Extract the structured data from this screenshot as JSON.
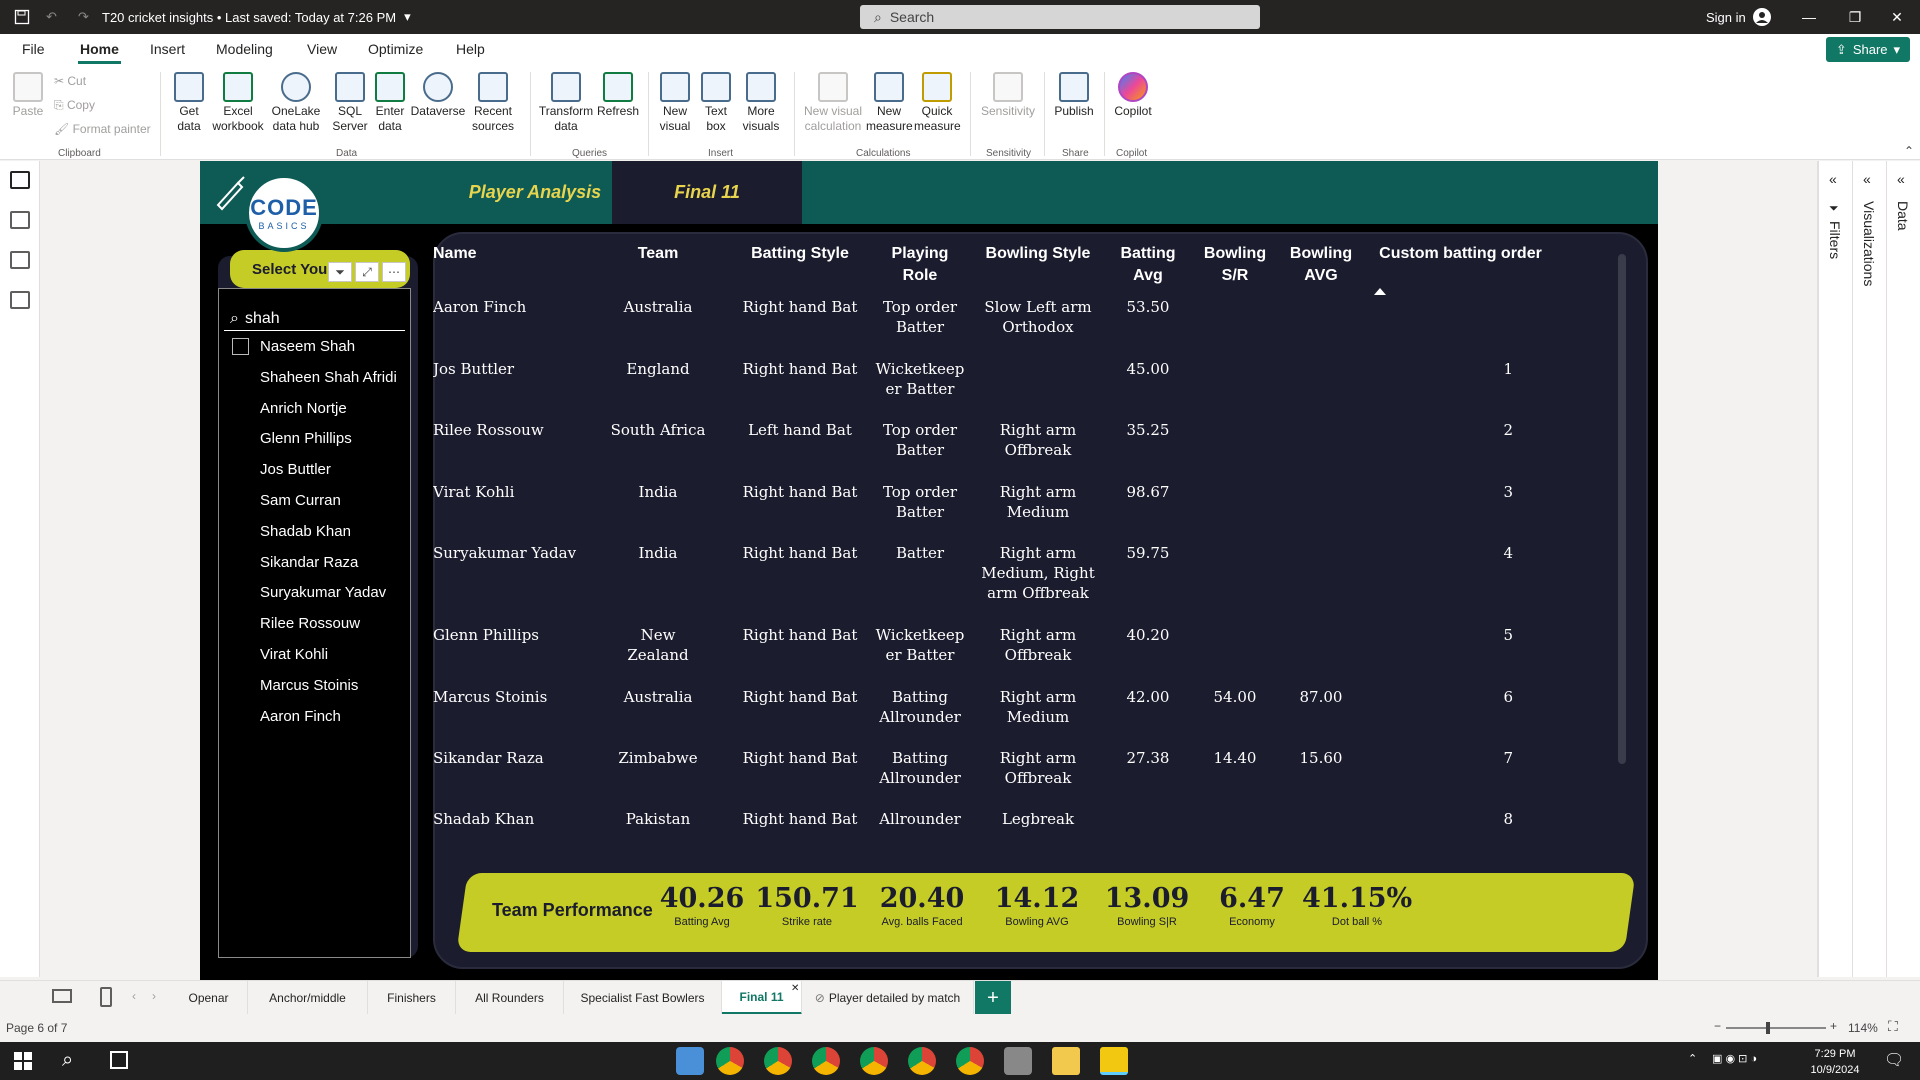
{
  "titlebar": {
    "title": "T20 cricket insights • Last saved: Today at 7:26 PM",
    "search_placeholder": "Search",
    "signin": "Sign in"
  },
  "menu": {
    "tabs": [
      "File",
      "Home",
      "Insert",
      "Modeling",
      "View",
      "Optimize",
      "Help"
    ],
    "share": "Share"
  },
  "ribbon": {
    "clipboard": {
      "paste": "Paste",
      "cut": "Cut",
      "copy": "Copy",
      "format_painter": "Format painter",
      "group": "Clipboard"
    },
    "data": {
      "get_data": "Get data",
      "excel": "Excel workbook",
      "onelake": "OneLake data hub",
      "sql": "SQL Server",
      "enter": "Enter data",
      "dataverse": "Dataverse",
      "recent": "Recent sources",
      "group": "Data"
    },
    "queries": {
      "transform": "Transform data",
      "refresh": "Refresh",
      "group": "Queries"
    },
    "insert": {
      "new_visual": "New visual",
      "text_box": "Text box",
      "more_visuals": "More visuals",
      "group": "Insert"
    },
    "calculations": {
      "new_visual_calc": "New visual calculation",
      "new_measure": "New measure",
      "quick_measure": "Quick measure",
      "group": "Calculations"
    },
    "sensitivity": {
      "sensitivity": "Sensitivity",
      "group": "Sensitivity"
    },
    "share": {
      "publish": "Publish",
      "group": "Share"
    },
    "copilot": {
      "copilot": "Copilot",
      "group": "Copilot"
    }
  },
  "report": {
    "nav": {
      "player_analysis": "Player Analysis",
      "final11": "Final 11"
    },
    "logo": {
      "line1": "CODE",
      "line2": "BASICS"
    },
    "slicer": {
      "title": "Select Your",
      "search_value": "shah",
      "items": [
        "Naseem Shah",
        "Shaheen Shah Afridi",
        "Anrich Nortje",
        "Glenn Phillips",
        "Jos Buttler",
        "Sam Curran",
        "Shadab Khan",
        "Sikandar Raza",
        "Suryakumar Yadav",
        "Rilee Rossouw",
        "Virat Kohli",
        "Marcus Stoinis",
        "Aaron Finch"
      ]
    },
    "table": {
      "headers": [
        "Name",
        "Team",
        "Batting Style",
        "Playing Role",
        "Bowling Style",
        "Batting Avg",
        "Bowling S/R",
        "Bowling AVG",
        "Custom batting order"
      ],
      "rows": [
        [
          "Aaron Finch",
          "Australia",
          "Right hand Bat",
          "Top order Batter",
          "Slow Left arm Orthodox",
          "53.50",
          "",
          "",
          ""
        ],
        [
          "Jos Buttler",
          "England",
          "Right hand Bat",
          "Wicketkeeper Batter",
          "",
          "45.00",
          "",
          "",
          "1"
        ],
        [
          "Rilee Rossouw",
          "South Africa",
          "Left hand Bat",
          "Top order Batter",
          "Right arm Offbreak",
          "35.25",
          "",
          "",
          "2"
        ],
        [
          "Virat Kohli",
          "India",
          "Right hand Bat",
          "Top order Batter",
          "Right arm Medium",
          "98.67",
          "",
          "",
          "3"
        ],
        [
          "Suryakumar Yadav",
          "India",
          "Right hand Bat",
          "Batter",
          "Right arm Medium, Right arm Offbreak",
          "59.75",
          "",
          "",
          "4"
        ],
        [
          "Glenn Phillips",
          "New Zealand",
          "Right hand Bat",
          "Wicketkeeper Batter",
          "Right arm Offbreak",
          "40.20",
          "",
          "",
          "5"
        ],
        [
          "Marcus Stoinis",
          "Australia",
          "Right hand Bat",
          "Batting Allrounder",
          "Right arm Medium",
          "42.00",
          "54.00",
          "87.00",
          "6"
        ],
        [
          "Sikandar Raza",
          "Zimbabwe",
          "Right hand Bat",
          "Batting Allrounder",
          "Right arm Offbreak",
          "27.38",
          "14.40",
          "15.60",
          "7"
        ],
        [
          "Shadab Khan",
          "Pakistan",
          "Right hand Bat",
          "Allrounder",
          "Legbreak",
          "",
          "",
          "",
          "8"
        ]
      ]
    },
    "team_performance": {
      "title": "Team Performance",
      "kpis": [
        {
          "value": "40.26",
          "label": "Batting Avg"
        },
        {
          "value": "150.71",
          "label": "Strike rate"
        },
        {
          "value": "20.40",
          "label": "Avg. balls Faced"
        },
        {
          "value": "14.12",
          "label": "Bowling AVG"
        },
        {
          "value": "13.09",
          "label": "Bowling S|R"
        },
        {
          "value": "6.47",
          "label": "Economy"
        },
        {
          "value": "41.15%",
          "label": "Dot ball %"
        }
      ]
    }
  },
  "panes": {
    "filters": "Filters",
    "visualizations": "Visualizations",
    "data": "Data"
  },
  "pages": {
    "tabs": [
      "Openar",
      "Anchor/middle",
      "Finishers",
      "All Rounders",
      "Specialist Fast Bowlers",
      "Final 11",
      "Player detailed by match"
    ],
    "active": "Final 11"
  },
  "status": {
    "page": "Page 6 of 7",
    "zoom": "114%"
  },
  "taskbar": {
    "time": "7:29 PM",
    "date": "10/9/2024"
  },
  "colors": {
    "accent": "#117865",
    "header_teal": "#0e5a55",
    "yellow": "#c5cc25",
    "panel_dark": "#1b1c2e"
  }
}
